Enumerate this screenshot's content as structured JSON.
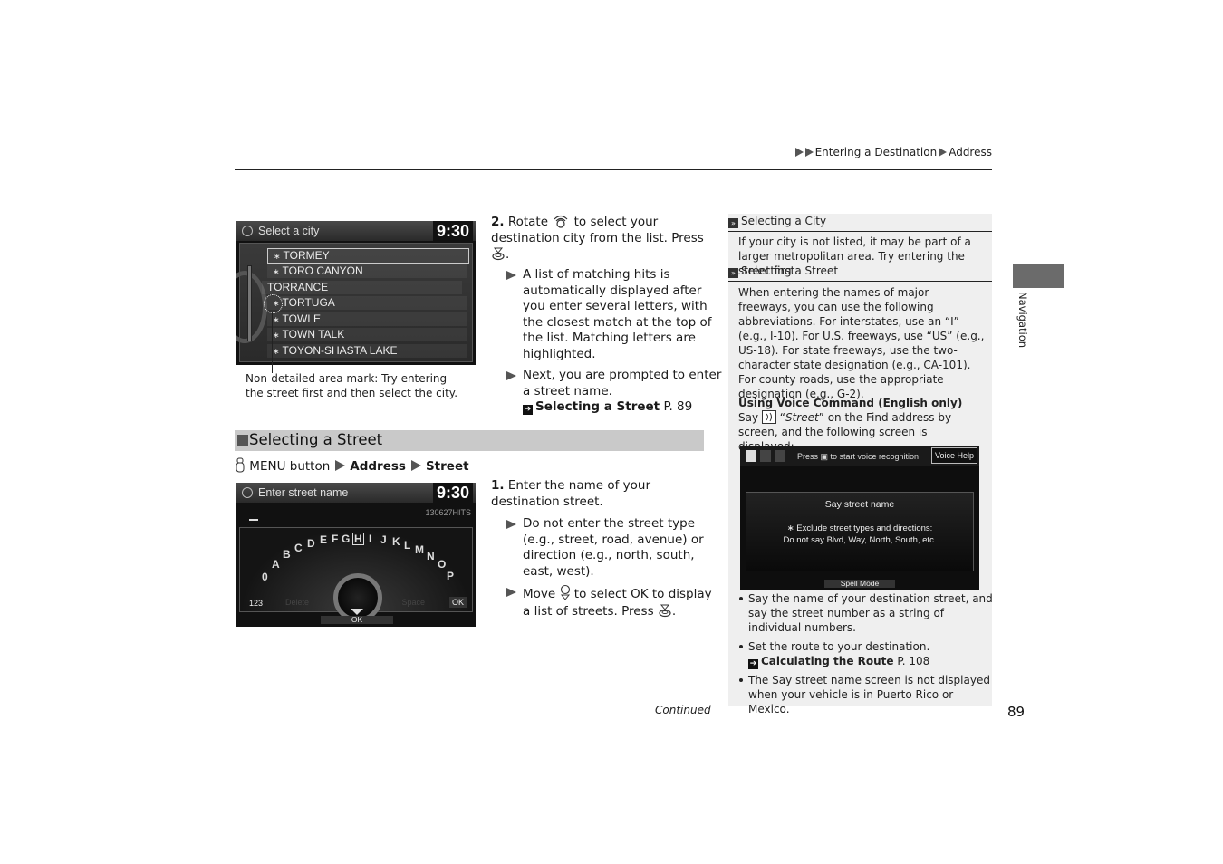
{
  "breadcrumb": {
    "items": [
      "Entering a Destination",
      "Address"
    ]
  },
  "city_screen": {
    "title": "Select a city",
    "clock": "9:30",
    "rows": [
      {
        "label": "TORMEY",
        "mark": "∗",
        "selected": true
      },
      {
        "label": "TORO CANYON",
        "mark": "∗",
        "selected": false
      },
      {
        "label": "TORRANCE",
        "mark": "",
        "selected": false
      },
      {
        "label": "TORTUGA",
        "mark": "∗",
        "selected": false
      },
      {
        "label": "TOWLE",
        "mark": "∗",
        "selected": false
      },
      {
        "label": "TOWN TALK",
        "mark": "∗",
        "selected": false
      },
      {
        "label": "TOYON-SHASTA LAKE",
        "mark": "∗",
        "selected": false
      }
    ],
    "caption": "Non-detailed area mark: Try entering the street first and then select the city."
  },
  "step2": {
    "number": "2.",
    "text_a": "Rotate",
    "text_b": "to select your destination city from the list. Press",
    "text_c": ".",
    "bullets": [
      "A list of matching hits is automatically displayed after you enter several letters, with the closest match at the top of the list. Matching letters are highlighted.",
      "Next, you are prompted to enter a street name."
    ],
    "xref": {
      "label": "Selecting a Street",
      "page": "P. 89"
    }
  },
  "section": {
    "title": "Selecting a Street",
    "menu_path": {
      "prefix": "MENU button",
      "items": [
        "Address",
        "Street"
      ]
    }
  },
  "street_screen": {
    "title": "Enter street name",
    "clock": "9:30",
    "hits": "130627HITS",
    "keys": [
      "0",
      "A",
      "B",
      "C",
      "D",
      "E",
      "F",
      "G",
      "H",
      "I",
      "J",
      "K",
      "L",
      "M",
      "N",
      "O",
      "P"
    ],
    "highlighted_key": "H",
    "label_123": "123",
    "ghost_delete": "Delete",
    "ghost_space": "Space",
    "ok_small": "OK",
    "ok_bottom": "OK"
  },
  "step1": {
    "number": "1.",
    "text": "Enter the name of your destination street.",
    "bullet1": "Do not enter the street type (e.g., street, road, avenue) or direction (e.g., north, south, east, west).",
    "bullet2_a": "Move",
    "bullet2_b": "to select",
    "bullet2_ok": "OK",
    "bullet2_c": "to display a list of streets. Press",
    "bullet2_d": "."
  },
  "sidebar": {
    "h1": "Selecting a City",
    "p1": "If your city is not listed, it may be part of a larger metropolitan area. Try entering the street first.",
    "h2": "Selecting a Street",
    "p2": "When entering the names of major freeways, you can use the following abbreviations. For interstates, use an “I” (e.g., I-10). For U.S. freeways, use “US” (e.g., US-18). For state freeways, use the two-character state designation (e.g., CA-101). For county roads, use the appropriate designation (e.g., G-2).",
    "voice_title": "Using Voice Command (English only)",
    "voice_a": "Say",
    "voice_street": "Street",
    "voice_b": "on the Find address by screen, and the following screen is displayed:",
    "voice_screen": {
      "press_text": "Press ▣ to start voice recognition",
      "help": "Voice Help",
      "line1": "Say street name",
      "line2": "∗ Exclude street types and directions:",
      "line3": "Do not say Blvd, Way, North, South, etc.",
      "spell": "Spell Mode"
    },
    "bullets": [
      "Say the name of your destination street, and say the street number as a string of individual numbers.",
      "Set the route to your destination.",
      "The Say street name screen is not displayed when your vehicle is in Puerto Rico or Mexico."
    ],
    "xref": {
      "label": "Calculating the Route",
      "page": "P. 108"
    }
  },
  "tab": {
    "label": "Navigation"
  },
  "footer": {
    "continued": "Continued",
    "page_number": "89"
  }
}
